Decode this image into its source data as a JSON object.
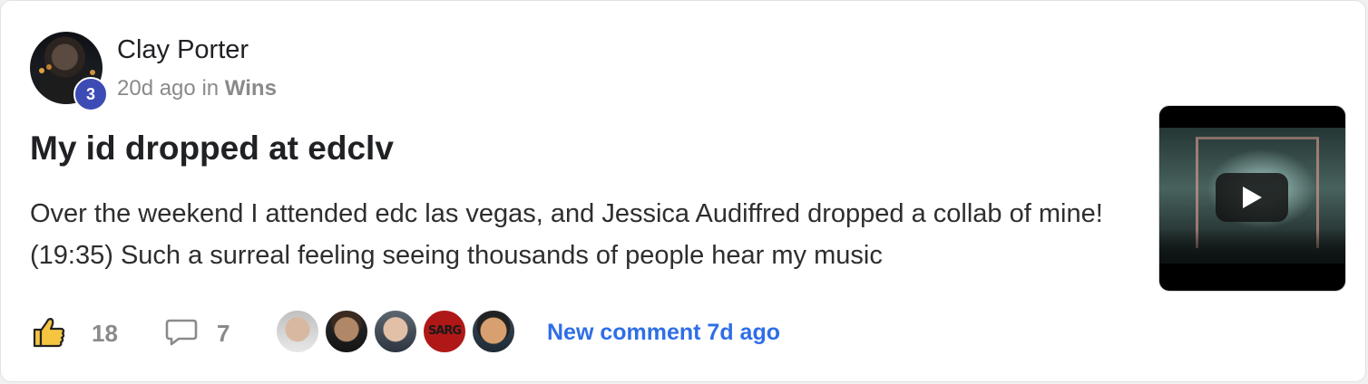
{
  "post": {
    "author": {
      "name": "Clay Porter",
      "level": "3"
    },
    "meta": {
      "time_ago": "20d ago",
      "in_label": "in",
      "category": "Wins"
    },
    "title": "My id dropped at edclv",
    "body": "Over the weekend I attended edc las vegas, and Jessica Audiffred dropped a collab of mine! (19:35) Such a surreal feeling seeing thousands of people hear my music",
    "video": {
      "icon": "play-icon"
    },
    "actions": {
      "like_icon": "thumbs-up-icon",
      "like_count": "18",
      "comment_icon": "speech-bubble-icon",
      "comment_count": "7",
      "commenter_badge_text": "SARG",
      "new_comment_label": "New comment 7d ago"
    }
  },
  "colors": {
    "level_badge": "#3d4bb5",
    "link_blue": "#2e6ee6",
    "like_icon_fill": "#f5c542",
    "muted_text": "#8a8a8a"
  }
}
